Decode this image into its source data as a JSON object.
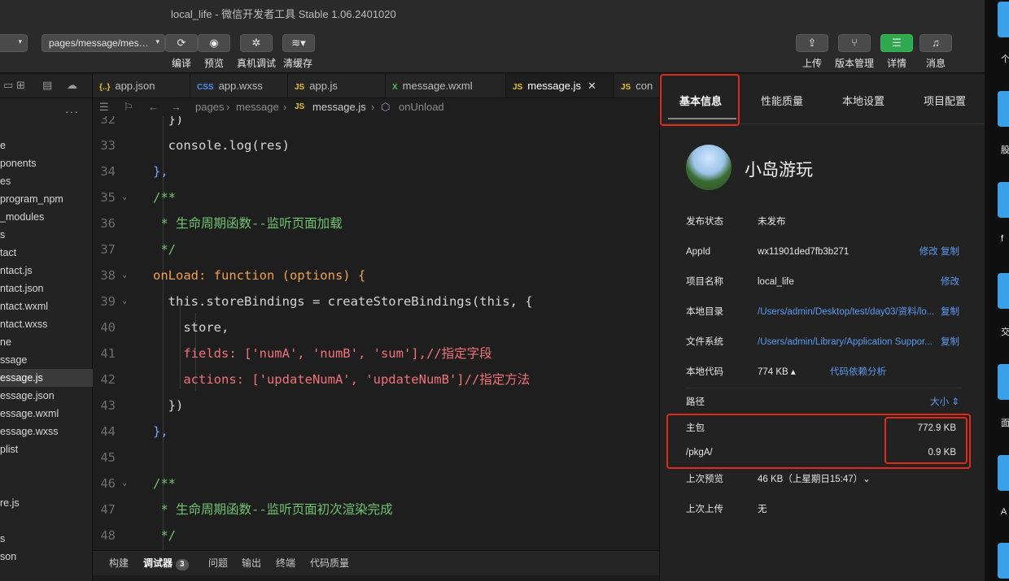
{
  "window": {
    "title": "local_life - 微信开发者工具 Stable 1.06.2401020"
  },
  "toolbar": {
    "page_select": "pages/message/mes…",
    "left": [
      {
        "label": "编译",
        "icon": "refresh-icon"
      },
      {
        "label": "预览",
        "icon": "eye-icon"
      },
      {
        "label": "真机调试",
        "icon": "bug-icon"
      },
      {
        "label": "清缓存",
        "icon": "layers-icon"
      }
    ],
    "right": [
      {
        "label": "上传",
        "icon": "upload-icon"
      },
      {
        "label": "版本管理",
        "icon": "branch-icon"
      },
      {
        "label": "详情",
        "icon": "menu-icon"
      },
      {
        "label": "消息",
        "icon": "bell-icon"
      }
    ]
  },
  "tree": {
    "more": "···",
    "items": [
      "e",
      "ponents",
      "es",
      "program_npm",
      "_modules",
      "s",
      "tact",
      "ntact.js",
      "ntact.json",
      "ntact.wxml",
      "ntact.wxss",
      "ne",
      "ssage",
      "essage.js",
      "essage.json",
      "essage.wxml",
      "essage.wxss",
      "plist",
      "",
      "",
      "re.js",
      "",
      "s",
      "son"
    ],
    "active_index": 13
  },
  "tabs": [
    {
      "icon": "{..}",
      "label": "app.json"
    },
    {
      "icon": "CSS",
      "label": "app.wxss"
    },
    {
      "icon": "JS",
      "label": "app.js"
    },
    {
      "icon": "X",
      "label": "message.wxml"
    },
    {
      "icon": "JS",
      "label": "message.js",
      "close": "✕"
    },
    {
      "icon": "JS",
      "label": "con"
    }
  ],
  "breadcrumb": {
    "folder1": "pages",
    "folder2": "message",
    "file": "message.js",
    "symbol": "onUnload"
  },
  "code": {
    "lines": [
      {
        "n": "32",
        "t": "  })"
      },
      {
        "n": "33",
        "t": "  console.log(res)"
      },
      {
        "n": "34",
        "t": "},"
      },
      {
        "n": "35",
        "t": "/**"
      },
      {
        "n": "36",
        "t": " * 生命周期函数--监听页面加载"
      },
      {
        "n": "37",
        "t": " */"
      },
      {
        "n": "38",
        "t": "onLoad: function (options) {"
      },
      {
        "n": "39",
        "t": "  this.storeBindings = createStoreBindings(this, {"
      },
      {
        "n": "40",
        "t": "    store,"
      },
      {
        "n": "41",
        "t": "    fields: ['numA', 'numB', 'sum'],//指定字段"
      },
      {
        "n": "42",
        "t": "    actions: ['updateNumA', 'updateNumB']//指定方法"
      },
      {
        "n": "43",
        "t": "  })"
      },
      {
        "n": "44",
        "t": "},"
      },
      {
        "n": "45",
        "t": ""
      },
      {
        "n": "46",
        "t": "/**"
      },
      {
        "n": "47",
        "t": " * 生命周期函数--监听页面初次渲染完成"
      },
      {
        "n": "48",
        "t": " */"
      }
    ]
  },
  "bottom": {
    "tabs": [
      "构建",
      "调试器",
      "问题",
      "输出",
      "终端",
      "代码质量"
    ],
    "badge": "3"
  },
  "details": {
    "tabs": [
      "基本信息",
      "性能质量",
      "本地设置",
      "项目配置"
    ],
    "project_name": "小岛游玩",
    "rows": [
      {
        "key": "发布状态",
        "value": "未发布"
      },
      {
        "key": "AppId",
        "value": "wx11901ded7fb3b271",
        "action": "修改 复制"
      },
      {
        "key": "项目名称",
        "value": "local_life",
        "action": "修改"
      },
      {
        "key": "本地目录",
        "value": "/Users/admin/Desktop/test/day03/资料/lo...",
        "action": "复制"
      },
      {
        "key": "文件系统",
        "value": "/Users/admin/Library/Application Suppor...",
        "action": "复制"
      },
      {
        "key": "本地代码",
        "value": "774 KB ▴",
        "link": "代码依赖分析"
      }
    ],
    "size_header": {
      "key": "路径",
      "sort": "大小 ⇕"
    },
    "packages": [
      {
        "path": "主包",
        "size": "772.9 KB"
      },
      {
        "path": "/pkgA/",
        "size": "0.9 KB"
      }
    ],
    "after": [
      {
        "key": "上次预览",
        "value": "46 KB（上星期日15:47）⌄"
      },
      {
        "key": "上次上传",
        "value": "无"
      }
    ]
  },
  "desktop_labels": [
    "个",
    "股",
    "f",
    "F",
    "交",
    "面",
    "A"
  ]
}
